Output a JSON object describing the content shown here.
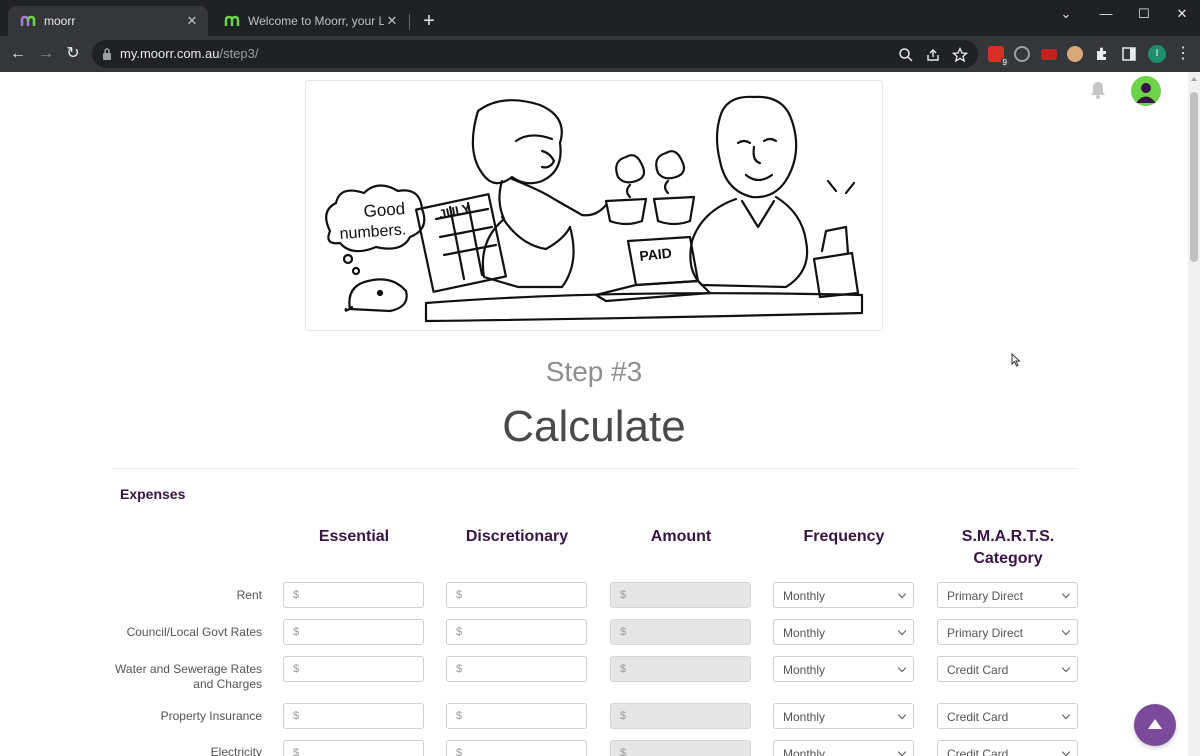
{
  "browser": {
    "tabs": [
      {
        "title": "moorr",
        "active": true
      },
      {
        "title": "Welcome to Moorr, your Lifestyle by",
        "active": false
      }
    ],
    "url_host": "my.moorr.com.au",
    "url_path": "/step3/",
    "extension_badge": "9",
    "profile_initial": "I"
  },
  "colors": {
    "brand_purple": "#3a1445",
    "fab_purple": "#7b4a9a",
    "avatar_green": "#6dd44a"
  },
  "page": {
    "step_label": "Step #3",
    "title": "Calculate",
    "section_title": "Expenses",
    "columns": [
      "Essential",
      "Discretionary",
      "Amount",
      "Frequency",
      "S.M.A.R.T.S. Category"
    ],
    "currency_placeholder": "$",
    "rows": [
      {
        "label": "Rent",
        "frequency": "Monthly",
        "category": "Primary Direct"
      },
      {
        "label": "Council/Local Govt Rates",
        "frequency": "Monthly",
        "category": "Primary Direct"
      },
      {
        "label": "Water and Sewerage Rates and Charges",
        "frequency": "Monthly",
        "category": "Credit Card"
      },
      {
        "label": "Property Insurance",
        "frequency": "Monthly",
        "category": "Credit Card"
      },
      {
        "label": "Electricity",
        "frequency": "Monthly",
        "category": "Credit Card"
      }
    ],
    "illustration": {
      "thought_bubble_text": "Good numbers.",
      "calendar_text": "JULY",
      "laptop_text": "PAID"
    }
  },
  "icons": {
    "bell": "bell-icon",
    "scroll_top": "arrow-up-icon"
  }
}
